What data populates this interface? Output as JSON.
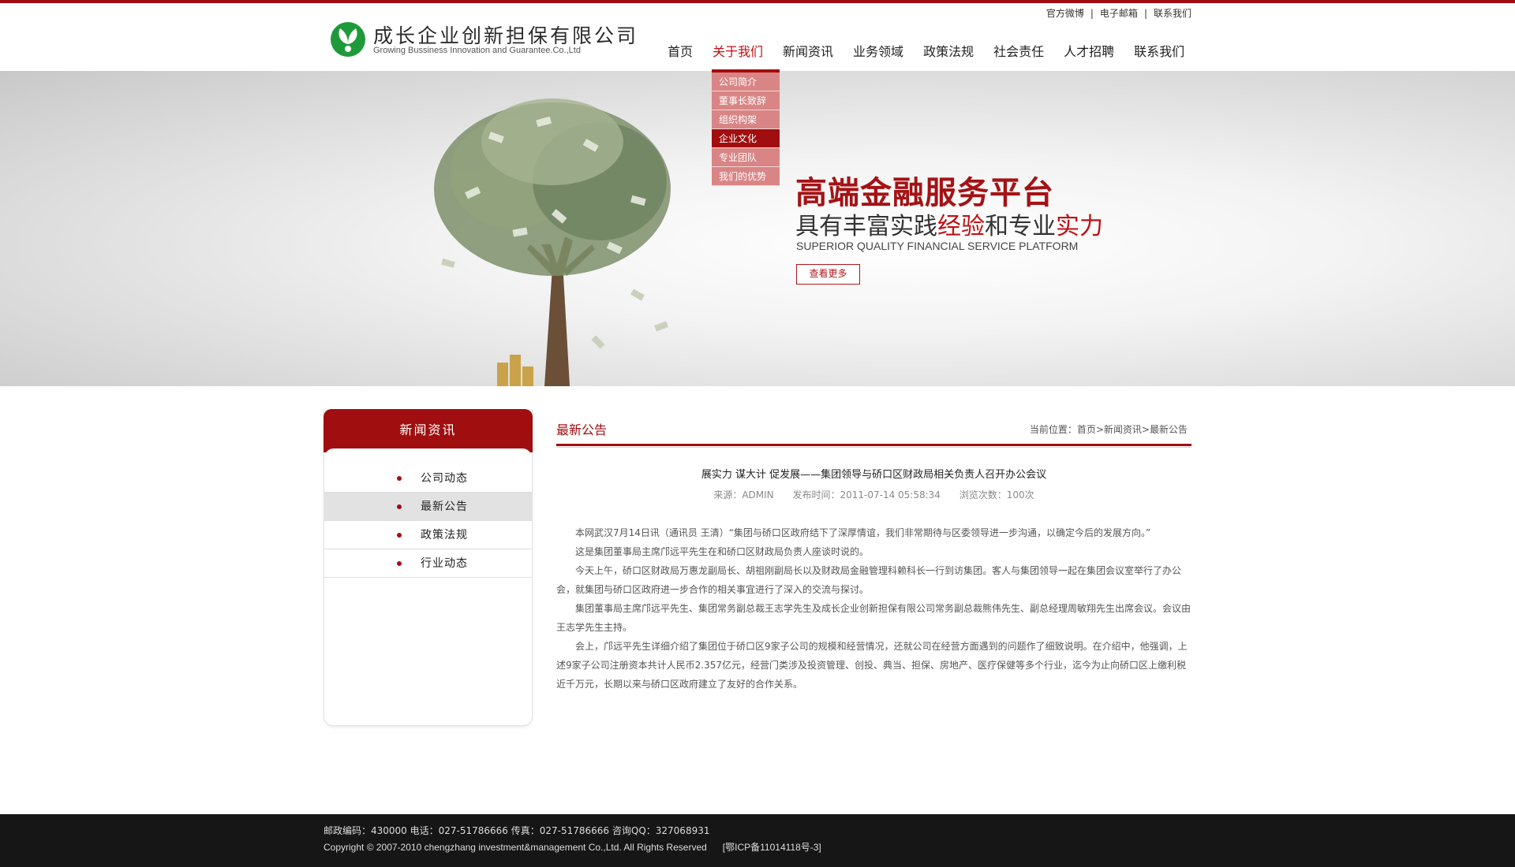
{
  "header": {
    "logo_cn": "成长企业创新担保有限公司",
    "logo_en": "Growing Bussiness Innovation and  Guarantee.Co.,Ltd",
    "toplinks": [
      "官方微博",
      "电子邮箱",
      "联系我们"
    ],
    "nav": [
      "首页",
      "关于我们",
      "新闻资讯",
      "业务领域",
      "政策法规",
      "社会责任",
      "人才招聘",
      "联系我们"
    ],
    "active_nav": "关于我们"
  },
  "dropdown": {
    "items": [
      "公司简介",
      "董事长致辞",
      "组织构架",
      "企业文化",
      "专业团队",
      "我们的优势"
    ],
    "active": "企业文化"
  },
  "banner": {
    "headline": "高端金融服务平台",
    "sub_part1": "具有丰富实践",
    "sub_highlight1": "经验",
    "sub_part2": "和专业",
    "sub_highlight2": "实力",
    "english": "SUPERIOR QUALITY FINANCIAL SERVICE PLATFORM",
    "button": "查看更多"
  },
  "sidebar": {
    "title": "新闻资讯",
    "items": [
      "公司动态",
      "最新公告",
      "政策法规",
      "行业动态"
    ],
    "active": "最新公告"
  },
  "main": {
    "section_title": "最新公告",
    "breadcrumb": "当前位置：首页>新闻资讯>最新公告",
    "article_title": "展实力 谋大计 促发展——集团领导与硚口区财政局相关负责人召开办公会议",
    "meta_source": "来源：ADMIN",
    "meta_date": "发布时间：2011-07-14 05:58:34",
    "meta_views": "浏览次数：100次",
    "paragraphs": [
      "本网武汉7月14日讯（通讯员 王清）“集团与硚口区政府结下了深厚情谊，我们非常期待与区委领导进一步沟通，以确定今后的发展方向。”",
      "这是集团董事局主席邝远平先生在和硚口区财政局负责人座谈时说的。",
      "今天上午，硚口区财政局万惠龙副局长、胡祖刚副局长以及财政局金融管理科赖科长一行到访集团。客人与集团领导一起在集团会议室举行了办公会，就集团与硚口区政府进一步合作的相关事宜进行了深入的交流与探讨。",
      "集团董事局主席邝远平先生、集团常务副总裁王志学先生及成长企业创新担保有限公司常务副总裁熊伟先生、副总经理周敏翔先生出席会议。会议由王志学先生主持。",
      "会上，邝远平先生详细介绍了集团位于硚口区9家子公司的规模和经营情况，还就公司在经营方面遇到的问题作了细致说明。在介绍中，他强调，上述9家子公司注册资本共计人民币2.357亿元，经营门类涉及投资管理、创投、典当、担保、房地产、医疗保健等多个行业，迄今为止向硚口区上缴利税近千万元，长期以来与硚口区政府建立了友好的合作关系。"
    ]
  },
  "footer": {
    "line1": "邮政编码：430000 电话：027-51786666 传真：027-51786666 咨询QQ：327068931",
    "copyright": "Copyright © 2007-2010 chengzhang investment&management Co.,Ltd. All Rights Reserved",
    "icp": "[鄂ICP备11014118号-3]"
  },
  "colors": {
    "accent": "#a00e10",
    "footer_bg": "#161616",
    "dropdown_item": "#d98585"
  }
}
